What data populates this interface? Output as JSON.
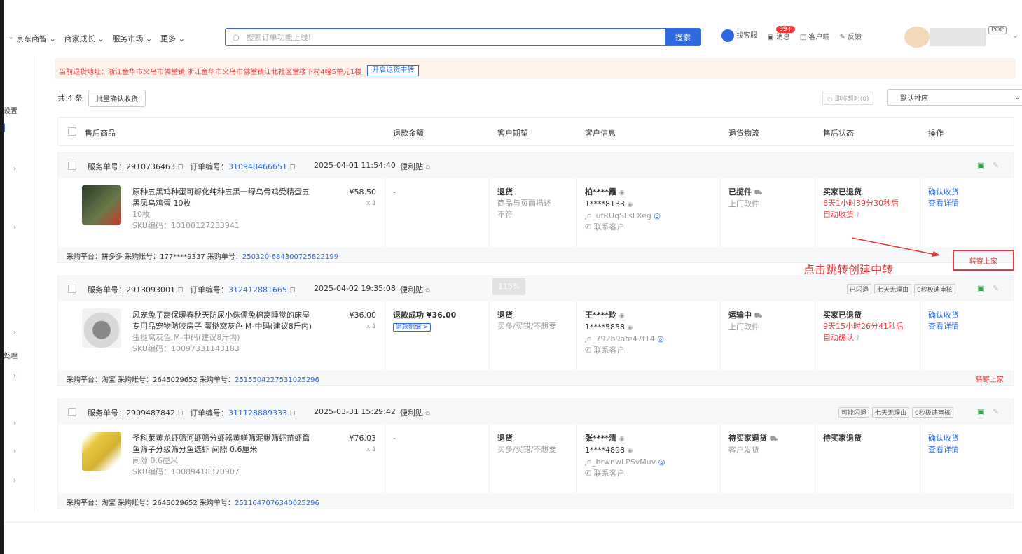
{
  "nav": {
    "items": [
      "京东商智",
      "商家成长",
      "服务市场",
      "更多"
    ],
    "search_placeholder": "搜索订单功能上线!",
    "search_button": "搜索",
    "tools": [
      "找客服",
      "消息",
      "客户端",
      "反馈"
    ],
    "msg_badge": "99+",
    "pop": "POP"
  },
  "sidebar": {
    "label1": "设置",
    "label2": "处理"
  },
  "notice": {
    "text": "当前退货地址：浙江金华市义乌市佛堂镇 浙江金华市义乌市佛堂镇江北社区堂楼下村4幢5单元1楼",
    "button": "开启退货中转"
  },
  "toolbar": {
    "count": "共 4 条",
    "batch_button": "批量确认收货",
    "timeout": "即将超时(0)",
    "sort": "默认排序"
  },
  "headers": [
    "售后商品",
    "退款金额",
    "客户期望",
    "客户信息",
    "退货物流",
    "售后状态",
    "操作"
  ],
  "orders": [
    {
      "service_label": "服务单号：",
      "service_no": "2910736463",
      "order_label": "订单编号：",
      "order_no": "310948466651",
      "time": "2025-04-01 11:54:40",
      "tag": "便利贴",
      "badges": [],
      "title1": "原种五黑鸡种蛋可孵化纯种五黑一绿乌骨鸡受精蛋五",
      "title2": "黑凤乌鸡蛋 10枚",
      "spec": "10枚",
      "sku": "SKU编码：10100127233941",
      "price": "¥58.50",
      "qty": "x 1",
      "refund": "-",
      "refund_link": "",
      "expect_type": "退货",
      "expect_reason": "商品与页面描述",
      "expect_reason2": "不符",
      "cust_name": "柏****霞",
      "cust_phone": "1****8133",
      "cust_id": "jd_ufRUqSLsLXeg",
      "cust_contact": "联系客户",
      "logistics": "已揽件",
      "logistics_sub": "上门取件",
      "status": "买家已退货",
      "status_time": "6天1小时39分30秒后",
      "status_action": "自动收货",
      "op1": "确认收货",
      "op2": "查看详情",
      "foot": "采购平台：拼多多   采购账号：177****9337   采购单号：",
      "foot_no": "250320-684300725822199",
      "foot_action": "转寄上家"
    },
    {
      "service_label": "服务单号：",
      "service_no": "2913093001",
      "order_label": "订单编号：",
      "order_no": "312412881665",
      "time": "2025-04-02 19:35:08",
      "tag": "便利贴",
      "badges": [
        "已闪退",
        "七天无理由",
        "0秒极速审核"
      ],
      "title1": "风宠兔子窝保暖春秋天防尿小侏儒兔棉窝睡觉的床屋",
      "title2": "专用品宠物防咬房子 蛋挞窝灰色 M-中码(建议8斤内)",
      "spec": "蛋挞窝灰色,M-中码(建议8斤内)",
      "sku": "SKU编码：10097331143183",
      "price": "¥36.00",
      "qty": "x 1",
      "refund": "退款成功 ¥36.00",
      "refund_link": "退款明细 >",
      "expect_type": "退货",
      "expect_reason": "买多/买错/不想要",
      "expect_reason2": "",
      "cust_name": "王****玲",
      "cust_phone": "1****5858",
      "cust_id": "jd_792b9afe47f14",
      "cust_contact": "联系客户",
      "logistics": "运输中",
      "logistics_sub": "上门取件",
      "status": "买家已退货",
      "status_time": "9天15小时26分41秒后",
      "status_action": "自动确认",
      "op1": "确认收货",
      "op2": "查看详情",
      "foot": "采购平台：淘宝   采购账号：2645029652   采购单号：",
      "foot_no": "2515504227531025296",
      "foot_action": "转寄上家"
    },
    {
      "service_label": "服务单号：",
      "service_no": "2909487842",
      "order_label": "订单编号：",
      "order_no": "311128889333",
      "time": "2025-03-31 15:29:42",
      "tag": "便利贴",
      "badges": [
        "可能闪退",
        "七天无理由",
        "0秒极速审核"
      ],
      "title1": "圣科莱黄龙虾筛河虾筛分虾器黄鳝筛泥鳅筛虾苗虾篇",
      "title2": "鱼筛子分级筛分鱼选虾 间隙 0.6厘米",
      "spec": "间隙 0.6厘米",
      "sku": "SKU编码：10089418370907",
      "price": "¥76.03",
      "qty": "x 1",
      "refund": "-",
      "refund_link": "",
      "expect_type": "退货",
      "expect_reason": "买多/买错/不想要",
      "expect_reason2": "",
      "cust_name": "张****清",
      "cust_phone": "1****4898",
      "cust_id": "jd_brwnwLPSvMuv",
      "cust_contact": "联系客户",
      "logistics": "待买家退货",
      "logistics_sub": "客户发货",
      "status": "待买家退货",
      "status_time": "",
      "status_action": "",
      "op1": "确认收货",
      "op2": "查看详情",
      "foot": "采购平台：淘宝   采购账号：2645029652   采购单号：",
      "foot_no": "2511647076340025296",
      "foot_action": ""
    }
  ],
  "annotation": "点击跳转创建中转",
  "watermark": "115%",
  "colors": {
    "accent": "#2d6ae0",
    "danger": "#e4393c",
    "notice_bg": "#fdf3ea"
  }
}
